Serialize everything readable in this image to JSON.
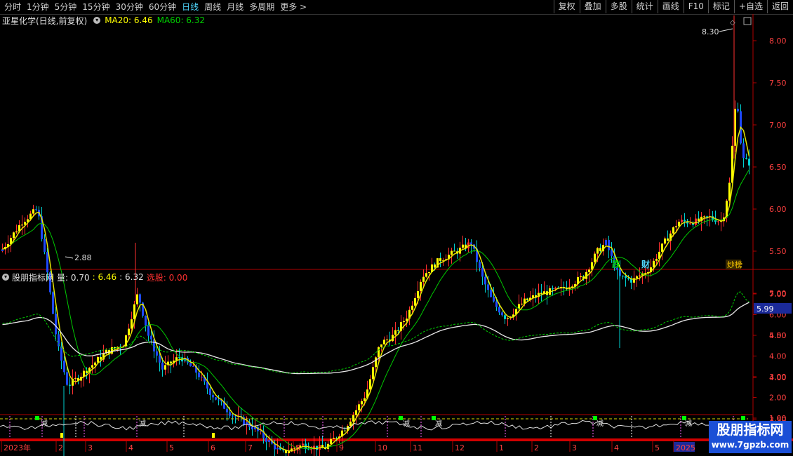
{
  "toolbar": {
    "periods": [
      "分时",
      "1分钟",
      "5分钟",
      "15分钟",
      "30分钟",
      "60分钟",
      "日线",
      "周线",
      "月线",
      "多周期",
      "更多 >"
    ],
    "active_period": "日线",
    "right_buttons": [
      "复权",
      "叠加",
      "多股",
      "统计",
      "画线",
      "F10",
      "标记",
      "+自选",
      "返回"
    ]
  },
  "main_chart": {
    "title": "亚星化学(日线,前复权)",
    "ma20_label": "MA20: 6.46",
    "ma60_label": "MA60: 6.32",
    "high_marker": "8.30",
    "low_marker": "2.88",
    "price_ticks": [
      "8.00",
      "7.50",
      "7.00",
      "6.50",
      "6.00",
      "5.50",
      "5.00",
      "4.50",
      "4.00",
      "3.50",
      "3.00"
    ],
    "event_labels": [
      "跌",
      "财",
      "炒榜"
    ]
  },
  "indicator": {
    "title": "股朋指标网",
    "vol_label": "量: 0.70",
    "v1": ": 6.46",
    "v2": ": 6.32",
    "select_label": "选股: 0.00",
    "current_value": "5.99",
    "ticks": [
      "7.00",
      "6.00",
      "5.00",
      "4.00",
      "3.00",
      "2.00",
      "1.00"
    ],
    "sub_marks": [
      "减",
      "减",
      "减",
      "减",
      "减",
      "减"
    ]
  },
  "time_axis": [
    "2023年",
    "2",
    "3",
    "4",
    "5",
    "6",
    "7",
    "8",
    "9",
    "10",
    "11",
    "12",
    "1",
    "2",
    "3",
    "4",
    "5",
    "2025"
  ],
  "watermark": {
    "line1": "股朋指标网",
    "line2": "www.7gpzb.com"
  },
  "colors": {
    "up": "#ff3030",
    "yellow": "#ffff00",
    "blue": "#1e48ff",
    "ma20": "#e6e600",
    "ma60": "#00c800",
    "accent": "#4fd8ff",
    "axis": "#b00000"
  }
}
